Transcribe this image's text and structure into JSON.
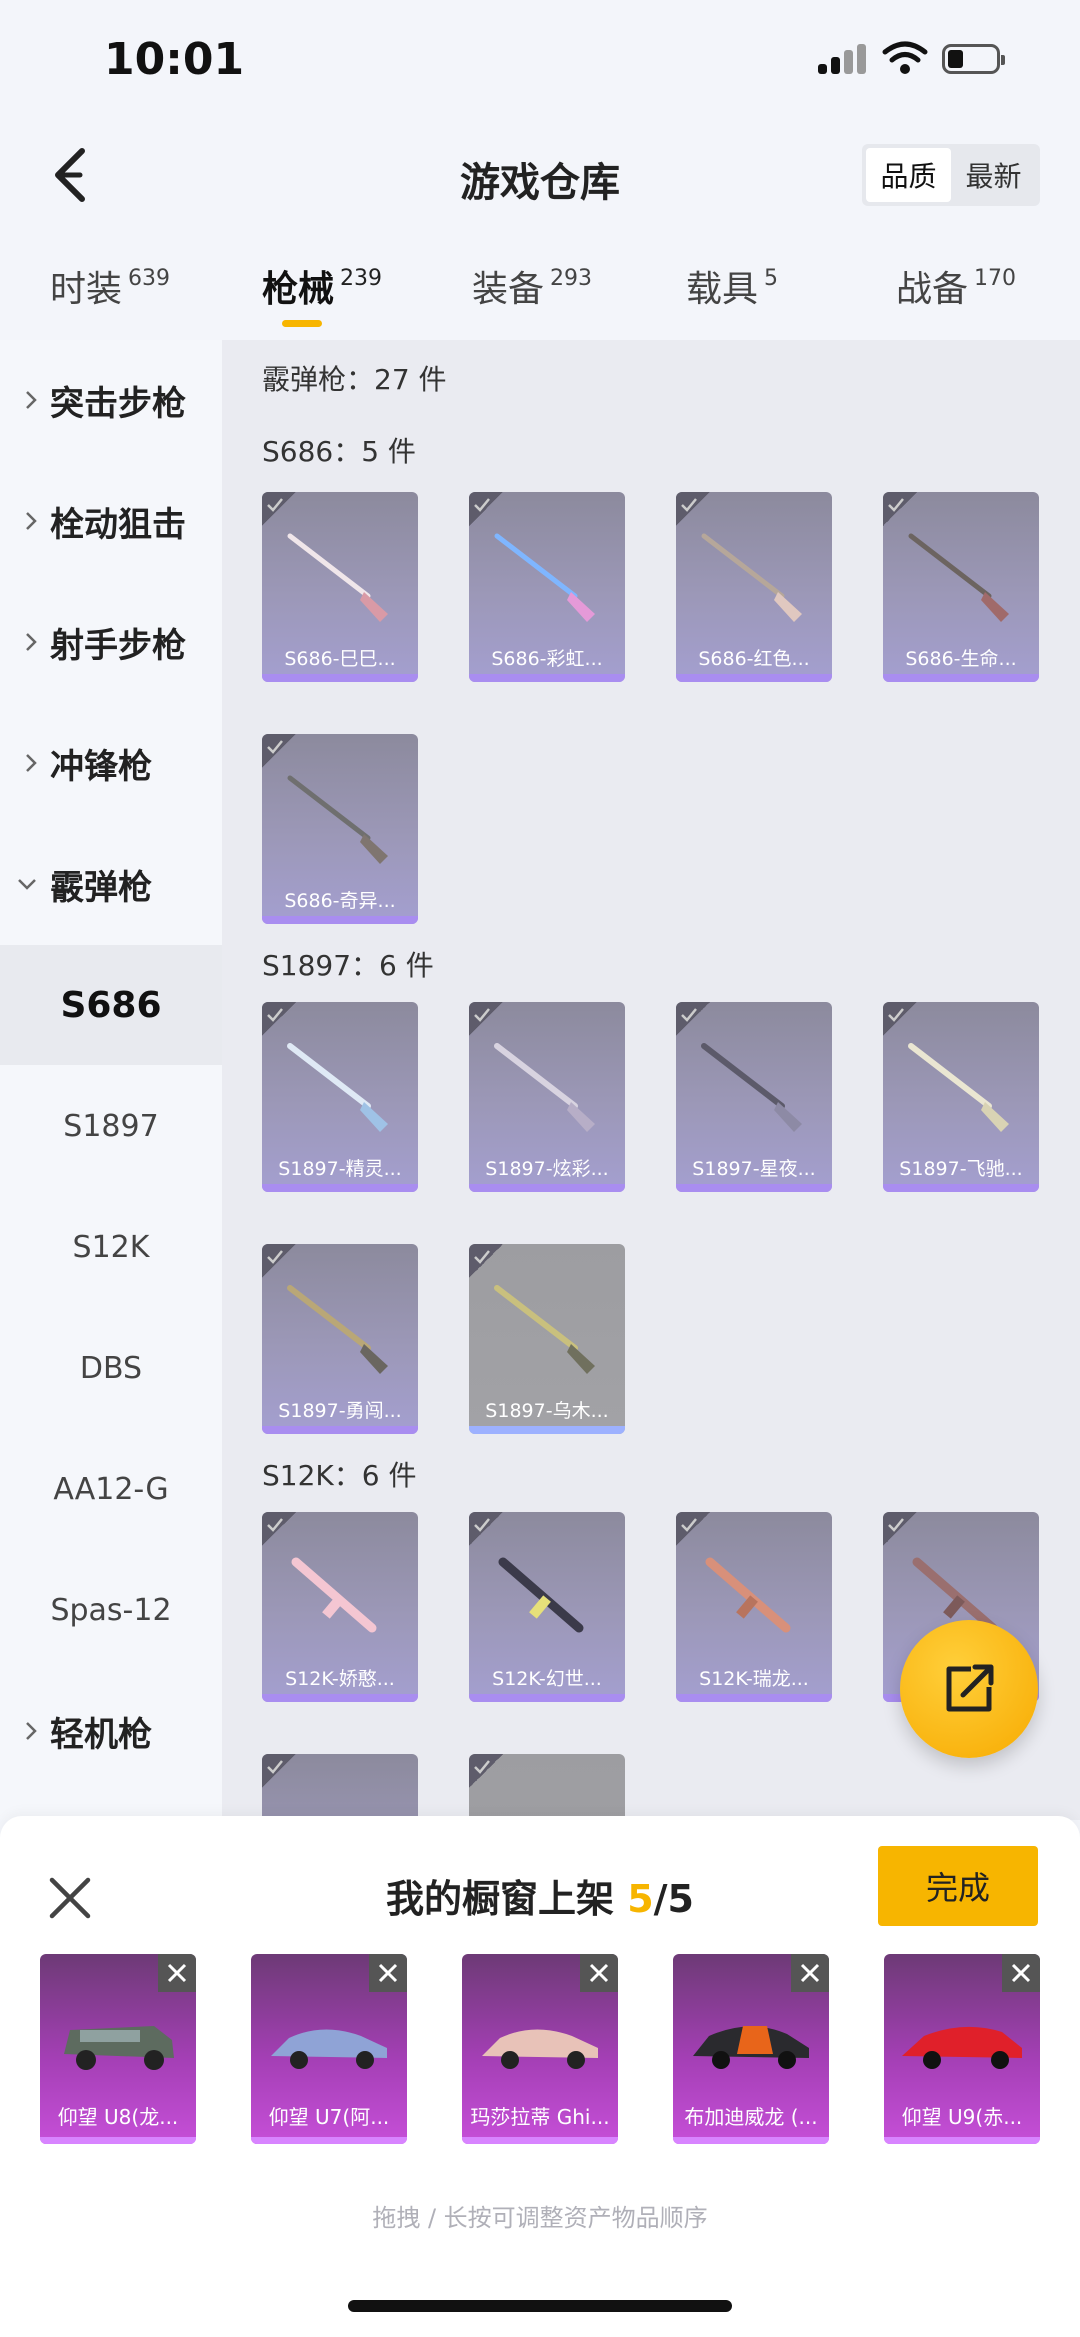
{
  "status_bar": {
    "time": "10:01"
  },
  "header": {
    "title": "游戏仓库",
    "sort_options": [
      "品质",
      "最新"
    ],
    "sort_active": "品质"
  },
  "tabs": [
    {
      "label": "时装",
      "count": "639"
    },
    {
      "label": "枪械",
      "count": "239"
    },
    {
      "label": "装备",
      "count": "293"
    },
    {
      "label": "载具",
      "count": "5"
    },
    {
      "label": "战备",
      "count": "170"
    }
  ],
  "active_tab": "枪械",
  "sidebar": {
    "groups": [
      "突击步枪",
      "栓动狙击",
      "射手步枪",
      "冲锋枪",
      "霰弹枪"
    ],
    "subitems": [
      "S686",
      "S1897",
      "S12K",
      "DBS",
      "AA12-G",
      "Spas-12"
    ],
    "after": "轻机枪",
    "active_subitem": "S686"
  },
  "main": {
    "category_summary": "霰弹枪：27 件",
    "sections": [
      {
        "label": "S686：5 件",
        "items": [
          "S686-巳巳...",
          "S686-彩虹...",
          "S686-红色...",
          "S686-生命...",
          "S686-奇异..."
        ]
      },
      {
        "label": "S1897：6 件",
        "items": [
          "S1897-精灵...",
          "S1897-炫彩...",
          "S1897-星夜...",
          "S1897-飞驰...",
          "S1897-勇闯...",
          "S1897-乌木..."
        ]
      },
      {
        "label": "S12K：6 件",
        "items": [
          "S12K-娇憨...",
          "S12K-幻世...",
          "S12K-瑞龙..."
        ]
      }
    ]
  },
  "panel": {
    "title_prefix": "我的橱窗上架 ",
    "count": "5",
    "total": "/5",
    "done_label": "完成",
    "shelf_items": [
      "仰望 U8(龙...",
      "仰望 U7(阿...",
      "玛莎拉蒂 Ghi...",
      "布加迪威龙 (...",
      "仰望 U9(赤..."
    ],
    "hint": "拖拽 / 长按可调整资产物品顺序"
  },
  "colors": {
    "accent": "#f7b500",
    "card_purple": "#a49fd0",
    "shelf_magenta": "#c64fd8"
  }
}
